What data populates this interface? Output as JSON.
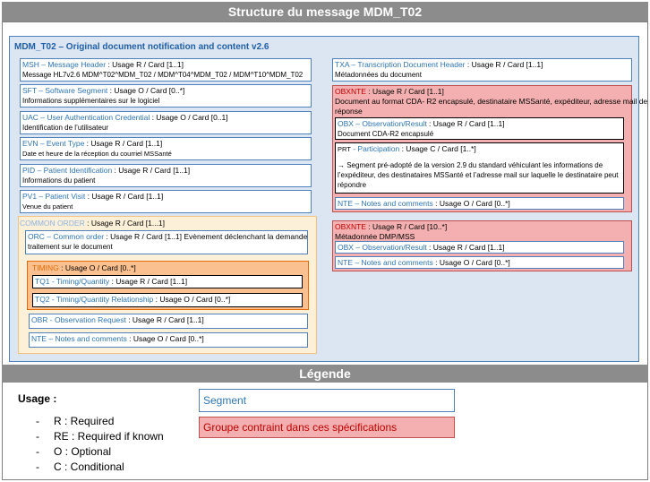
{
  "title": "Structure du message MDM_T02",
  "main_title": "MDM_T02 – Original document notification and content v2.6",
  "left": {
    "msh": {
      "name": "MSH – Message Header",
      "usage": " : Usage R / Card [1..1]",
      "desc": "Message HL7v2.6 MDM^T02^MDM_T02 / MDM^T04^MDM_T02 / MDM^T10^MDM_T02"
    },
    "sft": {
      "name": "SFT – Software Segment",
      "usage": " : Usage O / Card [0..*]",
      "desc": "Informations supplémentaires sur le logiciel"
    },
    "uac": {
      "name": "UAC – User Authentication Credential",
      "usage": " : Usage O / Card [0..1]",
      "desc": "Identification de l’utilisateur"
    },
    "evn": {
      "name": "EVN – Event Type",
      "usage": " : Usage R / Card [1..1]",
      "desc": "Date et heure de la réception du courriel MSSanté"
    },
    "pid": {
      "name": "PID – Patient Identification",
      "usage": " : Usage R / Card [1..1]",
      "desc": "Informations du patient"
    },
    "pv1": {
      "name": "PV1 – Patient Visit",
      "usage": " : Usage R / Card [1..1]",
      "desc": "Venue du patient"
    }
  },
  "common": {
    "name": "COMMON ORDER",
    "usage": " : Usage R / Card [1...1]",
    "orc": {
      "name": "ORC – Common order",
      "usage": " : Usage R / Card [1..1] Evènement déclenchant la demande de",
      "desc": "traitement sur le document"
    },
    "timing": {
      "name": "TIMING",
      "usage": " : Usage O / Card [0..*]"
    },
    "tq1": {
      "name": "TQ1 - Timing/Quantity",
      "usage": " : Usage R / Card [1..1]"
    },
    "tq2": {
      "name": "TQ2 - Timing/Quantity Relationship",
      "usage": " : Usage O / Card [0..*]"
    },
    "obr": {
      "name": "OBR - Observation Request",
      "usage": " : Usage R / Card [1..1]"
    },
    "nte": {
      "name": "NTE – Notes and comments",
      "usage": " : Usage O / Card [0..*]"
    }
  },
  "right": {
    "txa": {
      "name": "TXA – Transcription Document Header",
      "usage": " : Usage R / Card [1..1]",
      "desc": "Métadonnées du document"
    },
    "obxnte1": {
      "name": "OBXNTE",
      "usage": " : Usage R / Card [1..1]",
      "desc1": "Document au format CDA- R2 encapsulé, destinataire MSSanté, expéditeur, adresse mail de",
      "desc2": "réponse",
      "obx": {
        "name": "OBX – Observation/Result",
        "usage": " : Usage R / Card [1..1]",
        "desc": "Document CDA-R2 encapsulé"
      },
      "prt": {
        "code": "PRT",
        "name": " - Participation",
        "usage": " : Usage C / Card [1..*]",
        "desc1": "→ Segment pré-adopté de la version 2.9 du standard véhiculant les informations de",
        "desc2": "l’expéditeur, des destinataires MSSanté et l’adresse mail sur laquelle le destinataire peut",
        "desc3": "répondre"
      },
      "nte": {
        "name": "NTE – Notes and comments",
        "usage": " : Usage O / Card [0..*]"
      }
    },
    "obxnte2": {
      "name": "OBXNTE",
      "usage": " : Usage R / Card [10..*]",
      "desc": "Métadonnée DMP/MSS",
      "obx": {
        "name": "OBX – Observation/Result",
        "usage": " : Usage R / Card [1..1]"
      },
      "nte": {
        "name": "NTE – Notes and comments",
        "usage": " : Usage O / Card [0..*]"
      }
    }
  },
  "legend": {
    "title": "Légende",
    "usage_title": "Usage :",
    "items": [
      "R : Required",
      "RE : Required if known",
      "O : Optional",
      "C : Conditional"
    ],
    "dash": "-",
    "segment": "Segment",
    "group": "Groupe contraint dans ces spécifications"
  },
  "colors": {
    "segment_border": "#4f81bd",
    "group_fill": "#f4b0b0",
    "group_border": "#c0504d",
    "timing_fill": "#fac090",
    "common_fill": "#fdf0d8",
    "main_fill": "#dce6f2",
    "header_fill": "#8c8c8c"
  }
}
